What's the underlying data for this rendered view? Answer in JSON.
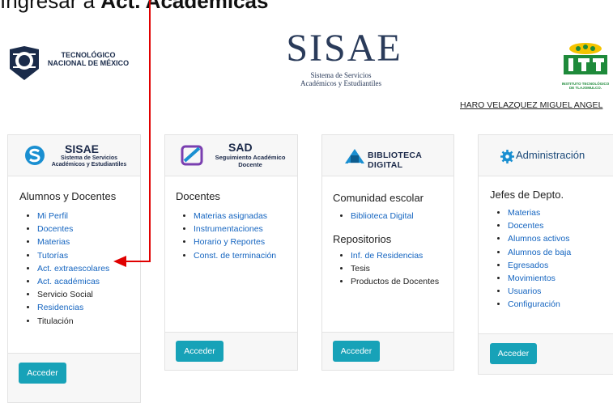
{
  "caption": {
    "prefix": "Ingresar a ",
    "strong": "Act. Académicas"
  },
  "header": {
    "tecnm_line1": "TECNOLÓGICO",
    "tecnm_line2": "NACIONAL DE MÉXICO",
    "sisae_title": "SISAE",
    "sisae_sub_line1": "Sistema de Servicios",
    "sisae_sub_line2": "Académicos y Estudiantiles",
    "itt_line1": "INSTITUTO TECNOLÓGICO",
    "itt_line2": "DE TLAJOMULCO.",
    "user_name": "HARO VELAZQUEZ MIGUEL ANGEL"
  },
  "cards": [
    {
      "logo_title": "SISAE",
      "logo_sub1": "Sistema de Servicios",
      "logo_sub2": "Académicos y Estudiantiles",
      "title": "Alumnos y Docentes",
      "items": [
        {
          "label": "Mi Perfil",
          "link": true
        },
        {
          "label": "Docentes",
          "link": true
        },
        {
          "label": "Materias",
          "link": true
        },
        {
          "label": "Tutorías",
          "link": true
        },
        {
          "label": "Act. extraescolares",
          "link": true
        },
        {
          "label": "Act. académicas",
          "link": true
        },
        {
          "label": "Servicio Social",
          "link": false
        },
        {
          "label": "Residencias",
          "link": true
        },
        {
          "label": "Titulación",
          "link": false
        }
      ],
      "button": "Acceder"
    },
    {
      "logo_title": "SAD",
      "logo_sub1": "Seguimiento Académico",
      "logo_sub2": "Docente",
      "title": "Docentes",
      "items": [
        {
          "label": "Materias asignadas",
          "link": true
        },
        {
          "label": "Instrumentaciones",
          "link": true
        },
        {
          "label": "Horario y Reportes",
          "link": true
        },
        {
          "label": "Const. de terminación",
          "link": true
        }
      ],
      "button": "Acceder"
    },
    {
      "logo_title": "BIBLIOTECA DIGITAL",
      "title": "Comunidad escolar",
      "items": [
        {
          "label": "Biblioteca Digital",
          "link": true
        }
      ],
      "title2": "Repositorios",
      "items2": [
        {
          "label": "Inf. de Residencias",
          "link": true
        },
        {
          "label": "Tesis",
          "link": false
        },
        {
          "label": "Productos de Docentes",
          "link": false
        }
      ],
      "button": "Acceder"
    },
    {
      "logo_title": "Administración",
      "title": "Jefes de Depto.",
      "items": [
        {
          "label": "Materias",
          "link": true
        },
        {
          "label": "Docentes",
          "link": true
        },
        {
          "label": "Alumnos activos",
          "link": true
        },
        {
          "label": "Alumnos de baja",
          "link": true
        },
        {
          "label": "Egresados",
          "link": true
        },
        {
          "label": "Movimientos",
          "link": true
        },
        {
          "label": "Usuarios",
          "link": true
        },
        {
          "label": "Configuración",
          "link": true
        }
      ],
      "button": "Acceder"
    }
  ],
  "colors": {
    "accent": "#17a2b8",
    "link": "#1565c0",
    "arrow": "#e00000"
  }
}
